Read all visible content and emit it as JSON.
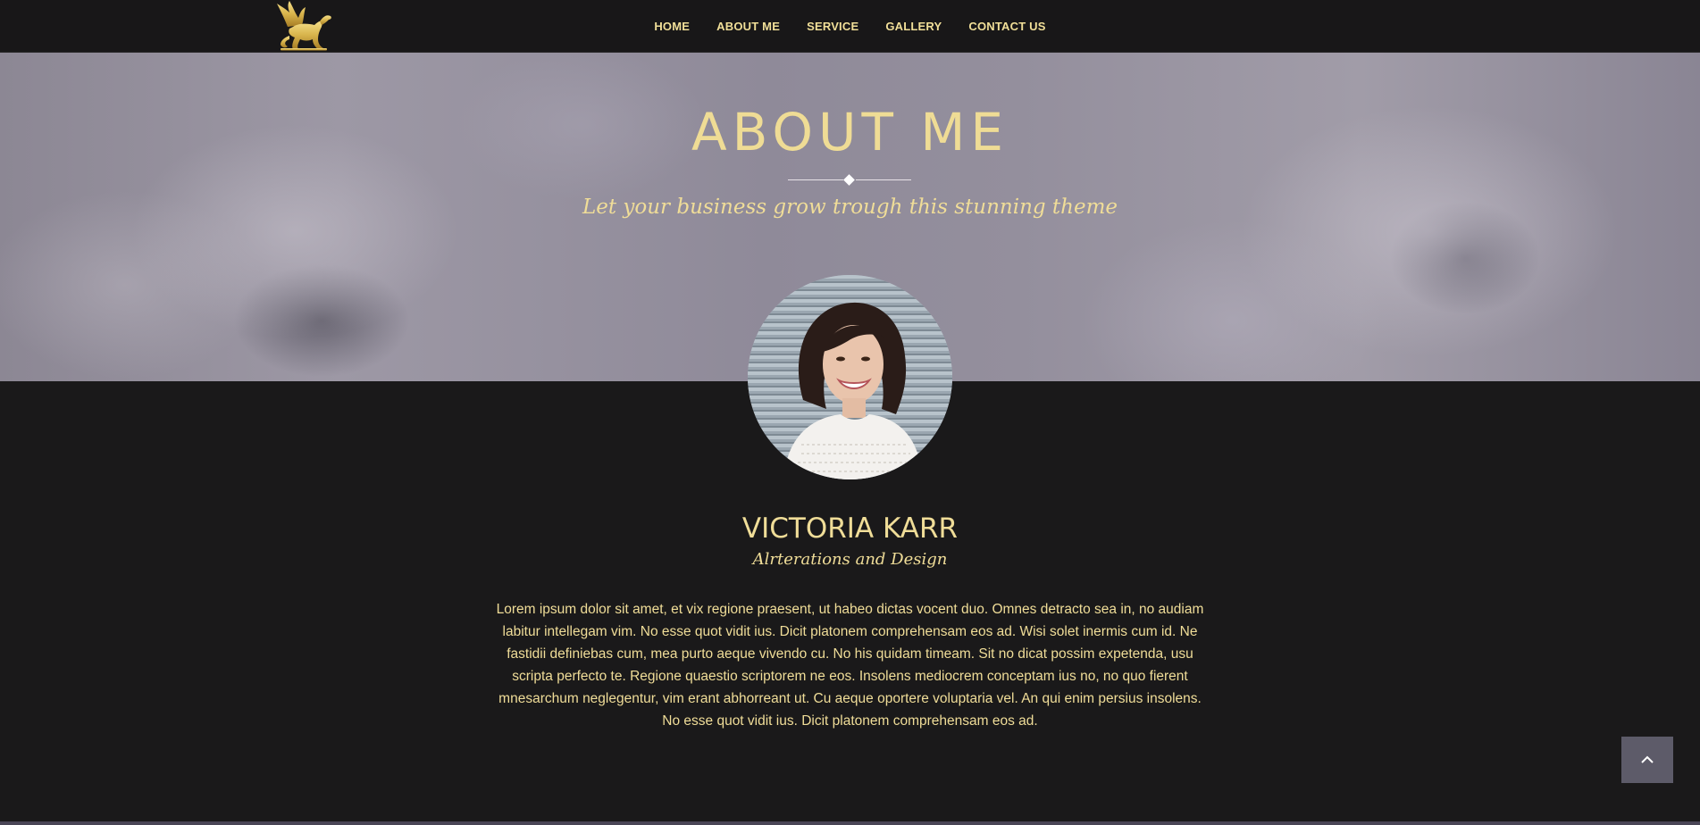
{
  "nav": {
    "items": [
      {
        "label": "HOME"
      },
      {
        "label": "ABOUT ME"
      },
      {
        "label": "SERVICE"
      },
      {
        "label": "GALLERY"
      },
      {
        "label": "CONTACT US"
      }
    ]
  },
  "hero": {
    "title": "ABOUT ME",
    "subtitle": "Let your business grow trough this stunning theme"
  },
  "profile": {
    "name": "VICTORIA KARR",
    "role": "Alrterations and Design",
    "bio": "Lorem ipsum dolor sit amet, et vix regione praesent, ut habeo dictas vocent duo. Omnes detracto sea in, no audiam labitur intellegam vim. No esse quot vidit ius. Dicit platonem comprehensam eos ad. Wisi solet inermis cum id. Ne fastidii definiebas cum, mea purto aeque vivendo cu. No his quidam timeam. Sit no dicat possim expetenda, usu scripta perfecto te. Regione quaestio scriptorem ne eos. Insolens mediocrem conceptam ius no, no quo fierent mnesarchum neglegentur, vim erant abhorreant ut. Cu aeque oportere voluptaria vel. An qui enim persius insolens. No esse quot vidit ius. Dicit platonem comprehensam eos ad."
  },
  "icons": {
    "logo": "griffin-logo-icon",
    "back_to_top": "chevron-up-icon"
  },
  "colors": {
    "accent_gold": "#f0dd98",
    "background_dark": "#1a191a",
    "back_to_top_bg": "#5d5b69"
  }
}
